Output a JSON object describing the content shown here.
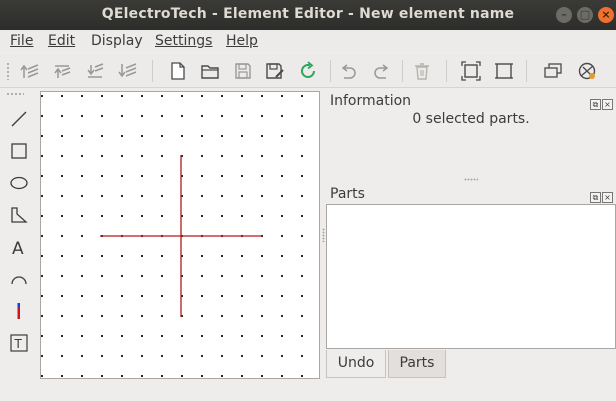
{
  "window": {
    "title": "QElectroTech - Element Editor - New element name"
  },
  "menu": [
    {
      "label": "File",
      "mnemonic": "F"
    },
    {
      "label": "Edit",
      "mnemonic": "E"
    },
    {
      "label": "Display",
      "mnemonic": "a"
    },
    {
      "label": "Settings",
      "mnemonic": "S"
    },
    {
      "label": "Help",
      "mnemonic": "H"
    }
  ],
  "toolbar": {
    "icons": [
      "bring-forward-icon",
      "raise-icon",
      "lower-icon",
      "send-backward-icon",
      "new-icon",
      "open-icon",
      "save-icon",
      "save-as-icon",
      "reload-icon",
      "undo-icon",
      "redo-icon",
      "delete-icon",
      "zoom-fit-icon",
      "zoom-reset-icon",
      "properties-icon",
      "check-icon"
    ]
  },
  "tools": [
    "line-tool",
    "rectangle-tool",
    "ellipse-tool",
    "polygon-tool",
    "text-tool",
    "arc-tool",
    "terminal-tool",
    "text-field-tool"
  ],
  "information": {
    "title": "Information",
    "selected_text": "0 selected parts."
  },
  "parts_panel": {
    "title": "Parts"
  },
  "tabs": {
    "undo": "Undo",
    "parts": "Parts"
  },
  "colors": {
    "crosshair": "#b31a1a",
    "accent": "#f0702e",
    "terminal_red": "#d0141a",
    "terminal_blue": "#1b3fd6"
  }
}
